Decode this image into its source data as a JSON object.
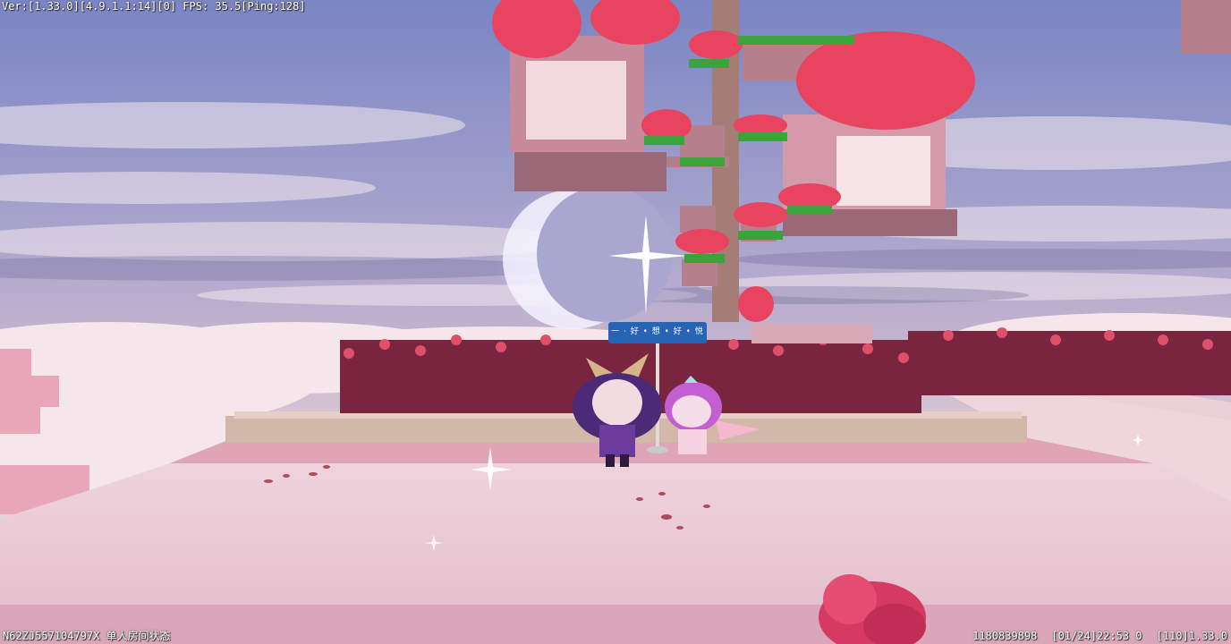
{
  "hud": {
    "version_label": "Ver:[1.33.0][4.9.1.1:14][0] FPS: 35.5[Ping:128]",
    "room_status": "N62ZJ557104797X 单人房间状态",
    "user_id": "1180839898",
    "datetime": "[01/24]22:53 0",
    "build": "[110]1.33.0"
  },
  "sign": {
    "text": "一 ‧ 好 • 想 • 好 • 悦"
  },
  "colors": {
    "sky_top": "#7c86c8",
    "sky_mid": "#b8b2d2",
    "clouds": "#f1e4ea",
    "floor": "#e9c9d3",
    "floor_front": "#d9a7b9",
    "walls": "#c98696",
    "blossom": "#e8435f",
    "leaves": "#3aa43a",
    "sign": "#2864b4"
  },
  "icons": {
    "moon": "crescent-moon-icon",
    "sparkle": "sparkle-icon",
    "flower": "rose-flower-icon"
  }
}
